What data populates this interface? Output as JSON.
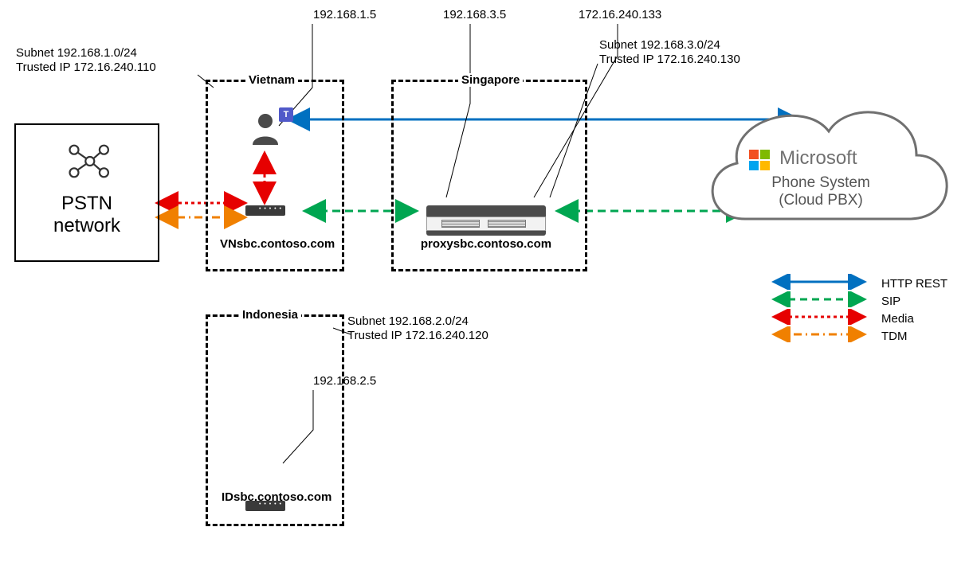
{
  "pstn": {
    "title_line1": "PSTN",
    "title_line2": "network"
  },
  "vietnam": {
    "region": "Vietnam",
    "subnet": "Subnet 192.168.1.0/24",
    "trusted": "Trusted IP 172.16.240.110",
    "ip": "192.168.1.5",
    "sbc": "VNsbc.contoso.com"
  },
  "singapore": {
    "region": "Singapore",
    "subnet": "Subnet 192.168.3.0/24",
    "trusted": "Trusted IP 172.16.240.130",
    "ip_internal": "192.168.3.5",
    "ip_external": "172.16.240.133",
    "sbc": "proxysbc.contoso.com"
  },
  "indonesia": {
    "region": "Indonesia",
    "subnet": "Subnet 192.168.2.0/24",
    "trusted": "Trusted IP 172.16.240.120",
    "ip": "192.168.2.5",
    "sbc": "IDsbc.contoso.com"
  },
  "cloud": {
    "brand": "Microsoft",
    "line1": "Phone System",
    "line2": "(Cloud PBX)"
  },
  "legend": {
    "http": "HTTP REST",
    "sip": "SIP",
    "media": "Media",
    "tdm": "TDM"
  },
  "colors": {
    "http": "#0070c0",
    "sip": "#00a651",
    "media": "#e60000",
    "tdm": "#f08000"
  }
}
